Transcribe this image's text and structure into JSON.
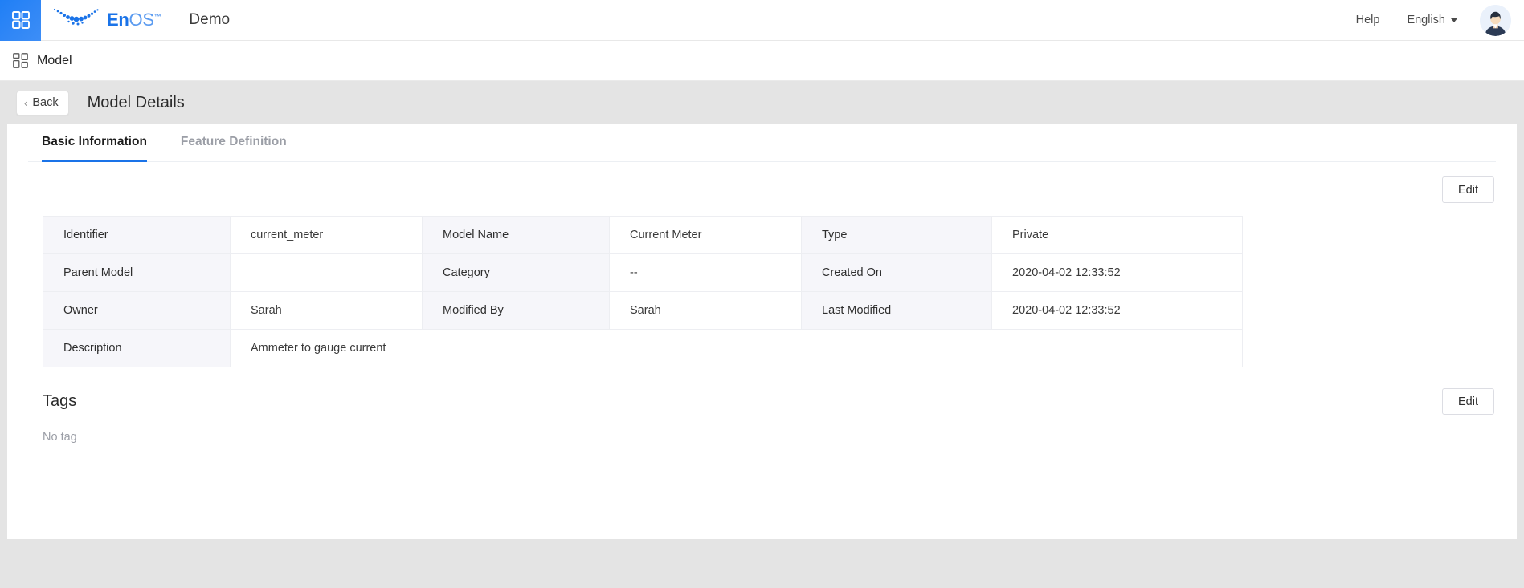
{
  "header": {
    "launcher_icon": "grid-apps-icon",
    "brand": {
      "en": "En",
      "os": "OS",
      "tm": "™",
      "mark_icon": "enos-dots-logo"
    },
    "tenant": "Demo",
    "help_label": "Help",
    "language_label": "English",
    "language_caret_icon": "chevron-down-icon",
    "avatar_icon": "user-avatar"
  },
  "breadcrumb": {
    "icon": "grid-module-icon",
    "label": "Model"
  },
  "page": {
    "back_label": "Back",
    "back_chevron": "‹",
    "title": "Model Details"
  },
  "tabs": [
    {
      "label": "Basic Information",
      "active": true
    },
    {
      "label": "Feature Definition",
      "active": false
    }
  ],
  "toolbar": {
    "edit_label": "Edit"
  },
  "info_table": {
    "rows": [
      [
        {
          "type": "label",
          "text": "Identifier"
        },
        {
          "type": "value",
          "text": "current_meter"
        },
        {
          "type": "label",
          "text": "Model Name"
        },
        {
          "type": "value",
          "text": "Current Meter"
        },
        {
          "type": "label",
          "text": "Type"
        },
        {
          "type": "value",
          "text": "Private"
        }
      ],
      [
        {
          "type": "label",
          "text": "Parent Model"
        },
        {
          "type": "value",
          "text": ""
        },
        {
          "type": "label",
          "text": "Category"
        },
        {
          "type": "value",
          "text": "--"
        },
        {
          "type": "label",
          "text": "Created On"
        },
        {
          "type": "value",
          "text": "2020-04-02 12:33:52"
        }
      ],
      [
        {
          "type": "label",
          "text": "Owner"
        },
        {
          "type": "value",
          "text": "Sarah"
        },
        {
          "type": "label",
          "text": "Modified By"
        },
        {
          "type": "value",
          "text": "Sarah"
        },
        {
          "type": "label",
          "text": "Last Modified"
        },
        {
          "type": "value",
          "text": "2020-04-02 12:33:52"
        }
      ],
      [
        {
          "type": "label",
          "text": "Description"
        },
        {
          "type": "value",
          "text": "Ammeter to gauge current",
          "span": 5
        }
      ]
    ]
  },
  "tags": {
    "title": "Tags",
    "edit_label": "Edit",
    "empty_text": "No tag"
  },
  "colors": {
    "accent_blue": "#1a73e8",
    "launcher_blue": "#2f86f6",
    "label_cell_bg": "#f6f6fa",
    "page_bg": "#e4e4e4",
    "muted_text": "#9b9ea6"
  }
}
